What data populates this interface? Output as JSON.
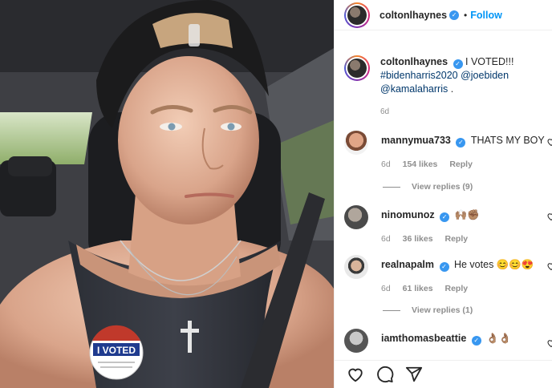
{
  "post": {
    "username": "coltonlhaynes",
    "follow_label": "Follow",
    "separator": "•",
    "caption_text": "I VOTED!!!",
    "caption_tags": [
      "#bidenharris2020",
      "@joebiden",
      "@kamalaharris"
    ],
    "caption_end": ".",
    "time": "6d",
    "sticker_text": "I VOTED"
  },
  "comments": [
    {
      "username": "mannymua733",
      "verified": true,
      "text": "THATS MY BOY",
      "time": "6d",
      "likes": "154 likes",
      "reply": "Reply",
      "view_replies": "View replies (9)"
    },
    {
      "username": "ninomunoz",
      "verified": true,
      "text": "🙌🏽✊🏽",
      "time": "6d",
      "likes": "36 likes",
      "reply": "Reply",
      "view_replies": ""
    },
    {
      "username": "realnapalm",
      "verified": true,
      "text": "He votes 😊😊😍",
      "time": "6d",
      "likes": "61 likes",
      "reply": "Reply",
      "view_replies": "View replies (1)"
    },
    {
      "username": "iamthomasbeattie",
      "verified": true,
      "text": "👌🏽👌🏽",
      "time": "",
      "likes": "",
      "reply": "",
      "view_replies": ""
    }
  ],
  "icons": {
    "verified": "verified-badge-icon",
    "like": "heart-icon",
    "comment": "comment-icon",
    "share": "paper-plane-icon"
  },
  "colors": {
    "link": "#00376b",
    "follow": "#0095f6",
    "verified": "#3897f0",
    "muted": "#8e8e8e"
  }
}
